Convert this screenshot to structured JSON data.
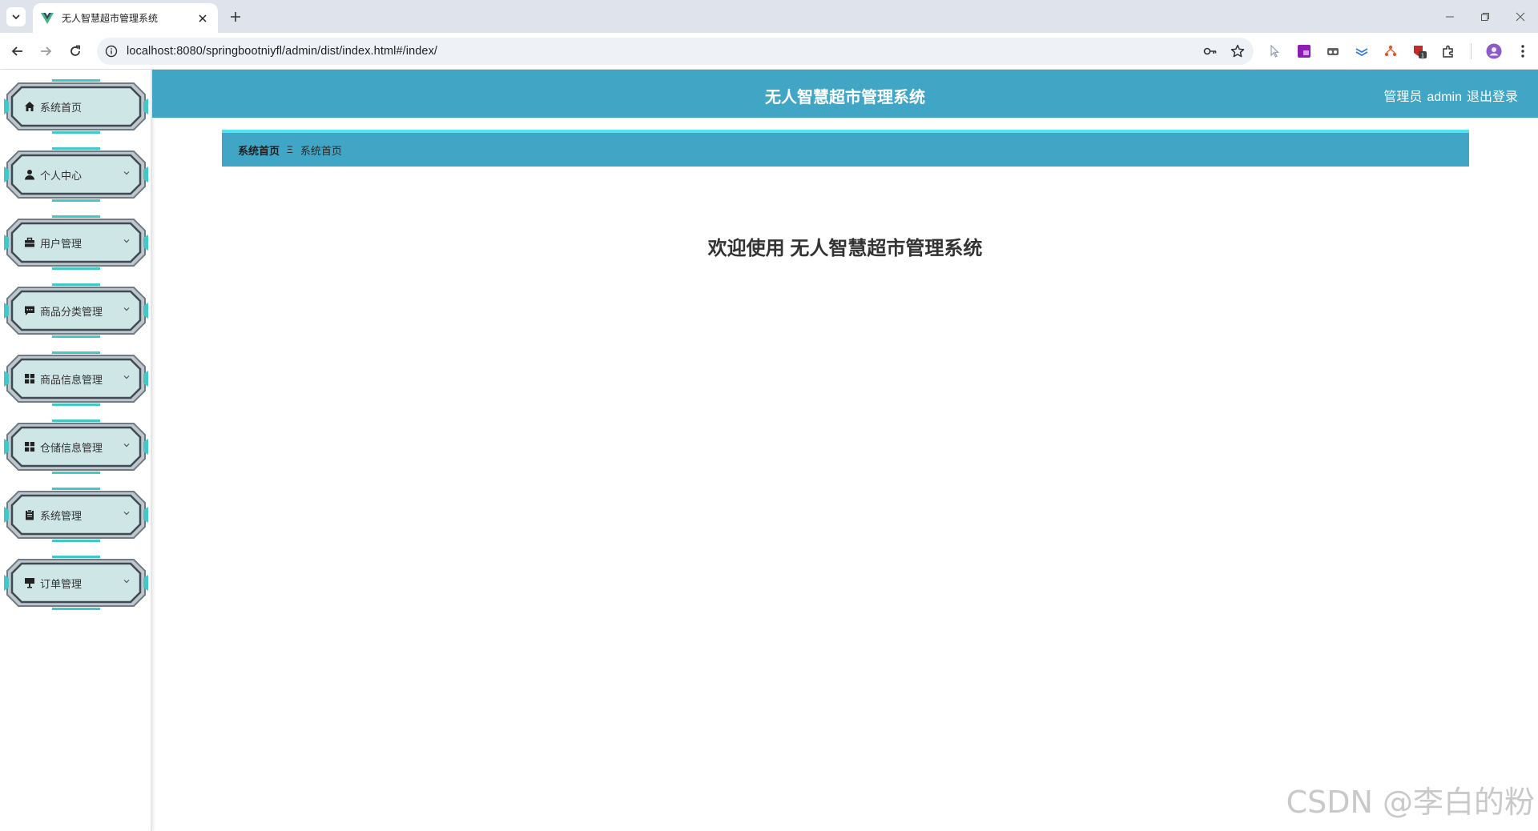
{
  "browser": {
    "tab_title": "无人智慧超市管理系统",
    "url": "localhost:8080/springbootniyfl/admin/dist/index.html#/index/"
  },
  "header": {
    "title": "无人智慧超市管理系统",
    "role": "管理员",
    "username": "admin",
    "logout": "退出登录"
  },
  "sidebar": {
    "items": [
      {
        "label": "系统首页",
        "icon": "home-icon",
        "has_submenu": false
      },
      {
        "label": "个人中心",
        "icon": "user-icon",
        "has_submenu": true
      },
      {
        "label": "用户管理",
        "icon": "briefcase-icon",
        "has_submenu": true
      },
      {
        "label": "商品分类管理",
        "icon": "message-icon",
        "has_submenu": true
      },
      {
        "label": "商品信息管理",
        "icon": "grid-icon",
        "has_submenu": true
      },
      {
        "label": "仓储信息管理",
        "icon": "grid-icon",
        "has_submenu": true
      },
      {
        "label": "系统管理",
        "icon": "clipboard-icon",
        "has_submenu": true
      },
      {
        "label": "订单管理",
        "icon": "sign-icon",
        "has_submenu": true
      }
    ]
  },
  "breadcrumb": {
    "home": "系统首页",
    "separator": "Ξ",
    "current": "系统首页"
  },
  "main": {
    "welcome": "欢迎使用 无人智慧超市管理系统"
  },
  "watermark": "CSDN @李白的粉",
  "colors": {
    "header_bg": "#41a5c6",
    "accent": "#4fe5f0",
    "menu_fill": "#cfe6e6"
  }
}
